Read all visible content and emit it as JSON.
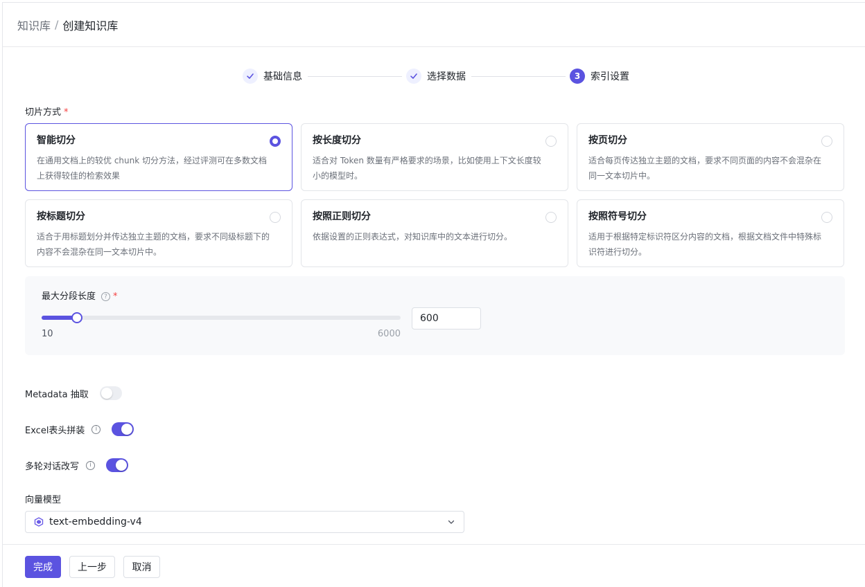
{
  "breadcrumb": {
    "root": "知识库",
    "separator": "/",
    "current": "创建知识库"
  },
  "steps": [
    {
      "label": "基础信息",
      "status": "done",
      "icon": "check-icon"
    },
    {
      "label": "选择数据",
      "status": "done",
      "icon": "check-icon"
    },
    {
      "label": "索引设置",
      "status": "current",
      "number": "3"
    }
  ],
  "chunking": {
    "label": "切片方式",
    "required_mark": "*",
    "selected": "智能切分",
    "options": [
      {
        "title": "智能切分",
        "desc": "在通用文档上的较优 chunk 切分方法，经过评测可在多数文档上获得较佳的检索效果",
        "selected": true
      },
      {
        "title": "按长度切分",
        "desc": "适合对 Token 数量有严格要求的场景，比如使用上下文长度较小的模型时。",
        "selected": false
      },
      {
        "title": "按页切分",
        "desc": "适合每页传达独立主题的文档，要求不同页面的内容不会混杂在同一文本切片中。",
        "selected": false
      },
      {
        "title": "按标题切分",
        "desc": "适合于用标题划分并传达独立主题的文档，要求不同级标题下的内容不会混杂在同一文本切片中。",
        "selected": false
      },
      {
        "title": "按照正则切分",
        "desc": "依据设置的正则表达式，对知识库中的文本进行切分。",
        "selected": false
      },
      {
        "title": "按照符号切分",
        "desc": "适用于根据特定标识符区分内容的文档，根据文档文件中特殊标识符进行切分。",
        "selected": false
      }
    ]
  },
  "max_segment": {
    "label": "最大分段长度",
    "help_icon": "question-circle-icon",
    "required_mark": "*",
    "value": "600",
    "min": "10",
    "max": "6000"
  },
  "toggles": {
    "metadata": {
      "label": "Metadata 抽取",
      "on": false
    },
    "excel_header": {
      "label": "Excel表头拼装",
      "info_icon": "info-circle-icon",
      "info_glyph": "i",
      "on": true
    },
    "multi_turn": {
      "label": "多轮对话改写",
      "info_icon": "info-circle-icon",
      "info_glyph": "i",
      "on": true
    }
  },
  "vector_model": {
    "label": "向量模型",
    "value": "text-embedding-v4",
    "icon": "model-logo-icon"
  },
  "footer": {
    "finish": "完成",
    "prev": "上一步",
    "cancel": "取消"
  },
  "colors": {
    "accent": "#5b53e0",
    "required": "#f53f3f",
    "border": "#e3e5e9"
  }
}
